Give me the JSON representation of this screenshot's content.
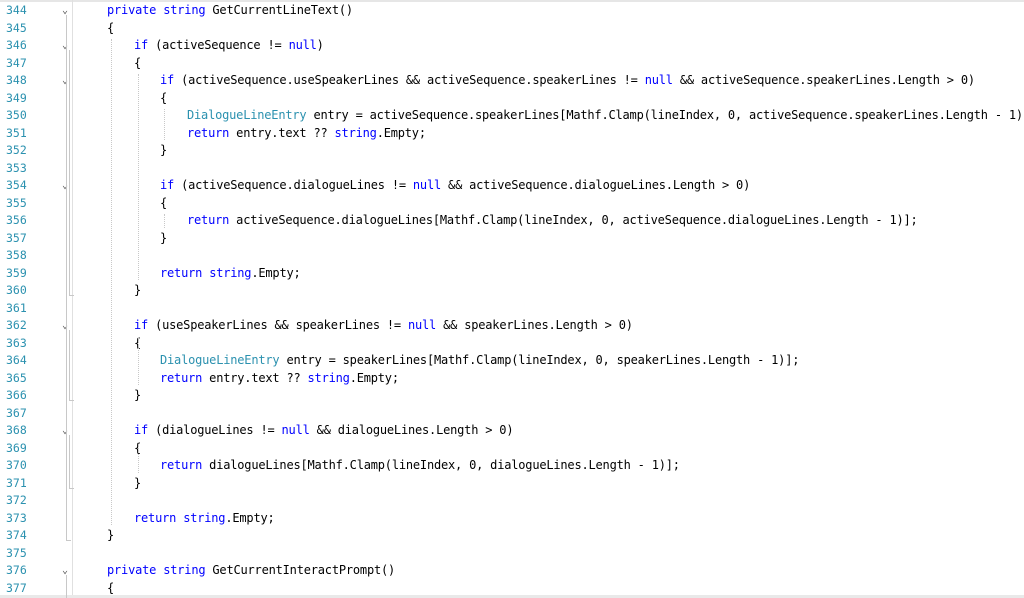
{
  "editor": {
    "lines": [
      {
        "num": "344",
        "fold": "⌄",
        "indent": 2,
        "tokens": [
          {
            "t": "private",
            "c": "kw"
          },
          {
            "t": " ",
            "c": "pl"
          },
          {
            "t": "string",
            "c": "kw"
          },
          {
            "t": " GetCurrentLineText()",
            "c": "pl"
          }
        ]
      },
      {
        "num": "345",
        "fold": "",
        "indent": 2,
        "tokens": [
          {
            "t": "{",
            "c": "pl"
          }
        ]
      },
      {
        "num": "346",
        "fold": "⌄",
        "indent": 3,
        "tokens": [
          {
            "t": "if",
            "c": "kw"
          },
          {
            "t": " (activeSequence != ",
            "c": "pl"
          },
          {
            "t": "null",
            "c": "kw"
          },
          {
            "t": ")",
            "c": "pl"
          }
        ]
      },
      {
        "num": "347",
        "fold": "",
        "indent": 3,
        "tokens": [
          {
            "t": "{",
            "c": "pl"
          }
        ]
      },
      {
        "num": "348",
        "fold": "⌄",
        "indent": 4,
        "tokens": [
          {
            "t": "if",
            "c": "kw"
          },
          {
            "t": " (activeSequence.useSpeakerLines && activeSequence.speakerLines != ",
            "c": "pl"
          },
          {
            "t": "null",
            "c": "kw"
          },
          {
            "t": " && activeSequence.speakerLines.Length > 0)",
            "c": "pl"
          }
        ]
      },
      {
        "num": "349",
        "fold": "",
        "indent": 4,
        "tokens": [
          {
            "t": "{",
            "c": "pl"
          }
        ]
      },
      {
        "num": "350",
        "fold": "",
        "indent": 5,
        "tokens": [
          {
            "t": "DialogueLineEntry",
            "c": "ty"
          },
          {
            "t": " entry = activeSequence.speakerLines[Mathf.Clamp(lineIndex, 0, activeSequence.speakerLines.Length - 1)];",
            "c": "pl"
          }
        ]
      },
      {
        "num": "351",
        "fold": "",
        "indent": 5,
        "tokens": [
          {
            "t": "return",
            "c": "kw"
          },
          {
            "t": " entry.text ?? ",
            "c": "pl"
          },
          {
            "t": "string",
            "c": "kw"
          },
          {
            "t": ".Empty;",
            "c": "pl"
          }
        ]
      },
      {
        "num": "352",
        "fold": "",
        "indent": 4,
        "tokens": [
          {
            "t": "}",
            "c": "pl"
          }
        ]
      },
      {
        "num": "353",
        "fold": "",
        "indent": 4,
        "tokens": []
      },
      {
        "num": "354",
        "fold": "⌄",
        "indent": 4,
        "tokens": [
          {
            "t": "if",
            "c": "kw"
          },
          {
            "t": " (activeSequence.dialogueLines != ",
            "c": "pl"
          },
          {
            "t": "null",
            "c": "kw"
          },
          {
            "t": " && activeSequence.dialogueLines.Length > 0)",
            "c": "pl"
          }
        ]
      },
      {
        "num": "355",
        "fold": "",
        "indent": 4,
        "tokens": [
          {
            "t": "{",
            "c": "pl"
          }
        ]
      },
      {
        "num": "356",
        "fold": "",
        "indent": 5,
        "tokens": [
          {
            "t": "return",
            "c": "kw"
          },
          {
            "t": " activeSequence.dialogueLines[Mathf.Clamp(lineIndex, 0, activeSequence.dialogueLines.Length - 1)];",
            "c": "pl"
          }
        ]
      },
      {
        "num": "357",
        "fold": "",
        "indent": 4,
        "tokens": [
          {
            "t": "}",
            "c": "pl"
          }
        ]
      },
      {
        "num": "358",
        "fold": "",
        "indent": 4,
        "tokens": []
      },
      {
        "num": "359",
        "fold": "",
        "indent": 4,
        "tokens": [
          {
            "t": "return",
            "c": "kw"
          },
          {
            "t": " ",
            "c": "pl"
          },
          {
            "t": "string",
            "c": "kw"
          },
          {
            "t": ".Empty;",
            "c": "pl"
          }
        ]
      },
      {
        "num": "360",
        "fold": "",
        "indent": 3,
        "tokens": [
          {
            "t": "}",
            "c": "pl"
          }
        ]
      },
      {
        "num": "361",
        "fold": "",
        "indent": 3,
        "tokens": []
      },
      {
        "num": "362",
        "fold": "⌄",
        "indent": 3,
        "tokens": [
          {
            "t": "if",
            "c": "kw"
          },
          {
            "t": " (useSpeakerLines && speakerLines != ",
            "c": "pl"
          },
          {
            "t": "null",
            "c": "kw"
          },
          {
            "t": " && speakerLines.Length > 0)",
            "c": "pl"
          }
        ]
      },
      {
        "num": "363",
        "fold": "",
        "indent": 3,
        "tokens": [
          {
            "t": "{",
            "c": "pl"
          }
        ]
      },
      {
        "num": "364",
        "fold": "",
        "indent": 4,
        "tokens": [
          {
            "t": "DialogueLineEntry",
            "c": "ty"
          },
          {
            "t": " entry = speakerLines[Mathf.Clamp(lineIndex, 0, speakerLines.Length - 1)];",
            "c": "pl"
          }
        ]
      },
      {
        "num": "365",
        "fold": "",
        "indent": 4,
        "tokens": [
          {
            "t": "return",
            "c": "kw"
          },
          {
            "t": " entry.text ?? ",
            "c": "pl"
          },
          {
            "t": "string",
            "c": "kw"
          },
          {
            "t": ".Empty;",
            "c": "pl"
          }
        ]
      },
      {
        "num": "366",
        "fold": "",
        "indent": 3,
        "tokens": [
          {
            "t": "}",
            "c": "pl"
          }
        ]
      },
      {
        "num": "367",
        "fold": "",
        "indent": 3,
        "tokens": []
      },
      {
        "num": "368",
        "fold": "⌄",
        "indent": 3,
        "tokens": [
          {
            "t": "if",
            "c": "kw"
          },
          {
            "t": " (dialogueLines != ",
            "c": "pl"
          },
          {
            "t": "null",
            "c": "kw"
          },
          {
            "t": " && dialogueLines.Length > 0)",
            "c": "pl"
          }
        ]
      },
      {
        "num": "369",
        "fold": "",
        "indent": 3,
        "tokens": [
          {
            "t": "{",
            "c": "pl"
          }
        ]
      },
      {
        "num": "370",
        "fold": "",
        "indent": 4,
        "tokens": [
          {
            "t": "return",
            "c": "kw"
          },
          {
            "t": " dialogueLines[Mathf.Clamp(lineIndex, 0, dialogueLines.Length - 1)];",
            "c": "pl"
          }
        ]
      },
      {
        "num": "371",
        "fold": "",
        "indent": 3,
        "tokens": [
          {
            "t": "}",
            "c": "pl"
          }
        ]
      },
      {
        "num": "372",
        "fold": "",
        "indent": 3,
        "tokens": []
      },
      {
        "num": "373",
        "fold": "",
        "indent": 3,
        "tokens": [
          {
            "t": "return",
            "c": "kw"
          },
          {
            "t": " ",
            "c": "pl"
          },
          {
            "t": "string",
            "c": "kw"
          },
          {
            "t": ".Empty;",
            "c": "pl"
          }
        ]
      },
      {
        "num": "374",
        "fold": "",
        "indent": 2,
        "tokens": [
          {
            "t": "}",
            "c": "pl"
          }
        ]
      },
      {
        "num": "375",
        "fold": "",
        "indent": 2,
        "tokens": []
      },
      {
        "num": "376",
        "fold": "⌄",
        "indent": 2,
        "tokens": [
          {
            "t": "private",
            "c": "kw"
          },
          {
            "t": " ",
            "c": "pl"
          },
          {
            "t": "string",
            "c": "kw"
          },
          {
            "t": " GetCurrentInteractPrompt()",
            "c": "pl"
          }
        ]
      },
      {
        "num": "377",
        "fold": "",
        "indent": 2,
        "tokens": [
          {
            "t": "{",
            "c": "pl"
          }
        ]
      }
    ]
  },
  "colors": {
    "keyword": "#0000ff",
    "type": "#2b91af",
    "line_number": "#2b91af",
    "plain": "#000000",
    "background": "#ffffff"
  }
}
